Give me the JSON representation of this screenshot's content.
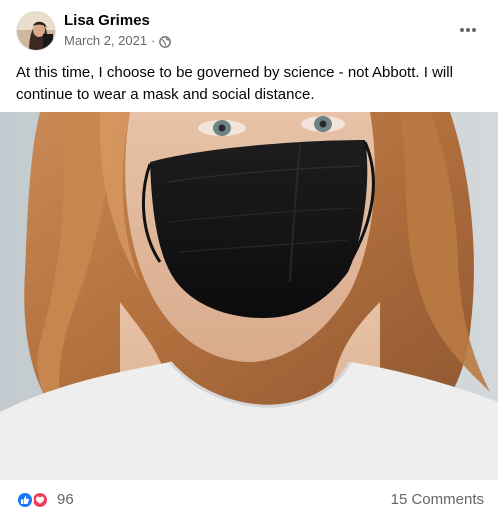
{
  "post": {
    "author": "Lisa Grimes",
    "timestamp": "March 2, 2021",
    "separator": "·",
    "privacy_icon": "globe-icon",
    "menu_icon": "more-options-icon",
    "text": "At this time, I choose to be governed by science - not Abbott. I will continue to wear a mask and social distance.",
    "image_description_icon": "photo",
    "reactions": {
      "icons": [
        "like-icon",
        "love-icon"
      ],
      "count": "96"
    },
    "comments_label": "15 Comments"
  },
  "colors": {
    "like_blue": "#1877f2",
    "love_red": "#f33e58",
    "secondary_text": "#65676b",
    "primary_text": "#050505"
  }
}
